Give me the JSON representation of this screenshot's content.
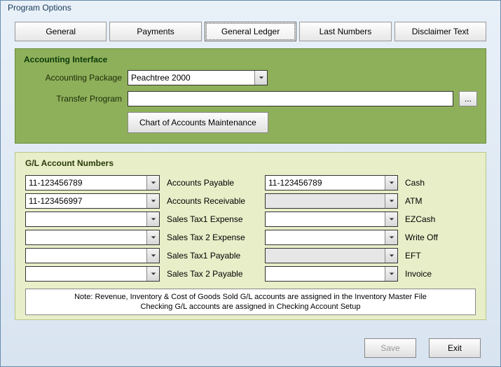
{
  "window": {
    "title": "Program Options"
  },
  "tabs": {
    "general": "General",
    "payments": "Payments",
    "general_ledger": "General Ledger",
    "last_numbers": "Last Numbers",
    "disclaimer": "Disclaimer Text"
  },
  "accounting_interface": {
    "legend": "Accounting Interface",
    "package_label": "Accounting Package",
    "package_value": "Peachtree 2000",
    "transfer_label": "Transfer Program",
    "transfer_value": "",
    "browse_label": "...",
    "chart_btn": "Chart of Accounts Maintenance"
  },
  "gl": {
    "legend": "G/L Account Numbers",
    "left": [
      {
        "value": "11-123456789",
        "label": "Accounts Payable"
      },
      {
        "value": "11-123456997",
        "label": "Accounts Receivable"
      },
      {
        "value": "",
        "label": "Sales Tax1 Expense"
      },
      {
        "value": "",
        "label": "Sales Tax 2 Expense"
      },
      {
        "value": "",
        "label": "Sales Tax1 Payable"
      },
      {
        "value": "",
        "label": "Sales Tax 2 Payable"
      }
    ],
    "right": [
      {
        "value": "11-123456789",
        "label": "Cash",
        "disabled": false
      },
      {
        "value": "",
        "label": "ATM",
        "disabled": true
      },
      {
        "value": "",
        "label": "EZCash",
        "disabled": false
      },
      {
        "value": "",
        "label": "Write Off",
        "disabled": false
      },
      {
        "value": "",
        "label": "EFT",
        "disabled": true
      },
      {
        "value": "",
        "label": "Invoice",
        "disabled": false
      }
    ],
    "note_line1": "Note: Revenue, Inventory & Cost of Goods Sold G/L accounts are assigned in the Inventory Master File",
    "note_line2": "Checking G/L accounts are assigned in Checking Account Setup"
  },
  "footer": {
    "save": "Save",
    "exit": "Exit"
  }
}
